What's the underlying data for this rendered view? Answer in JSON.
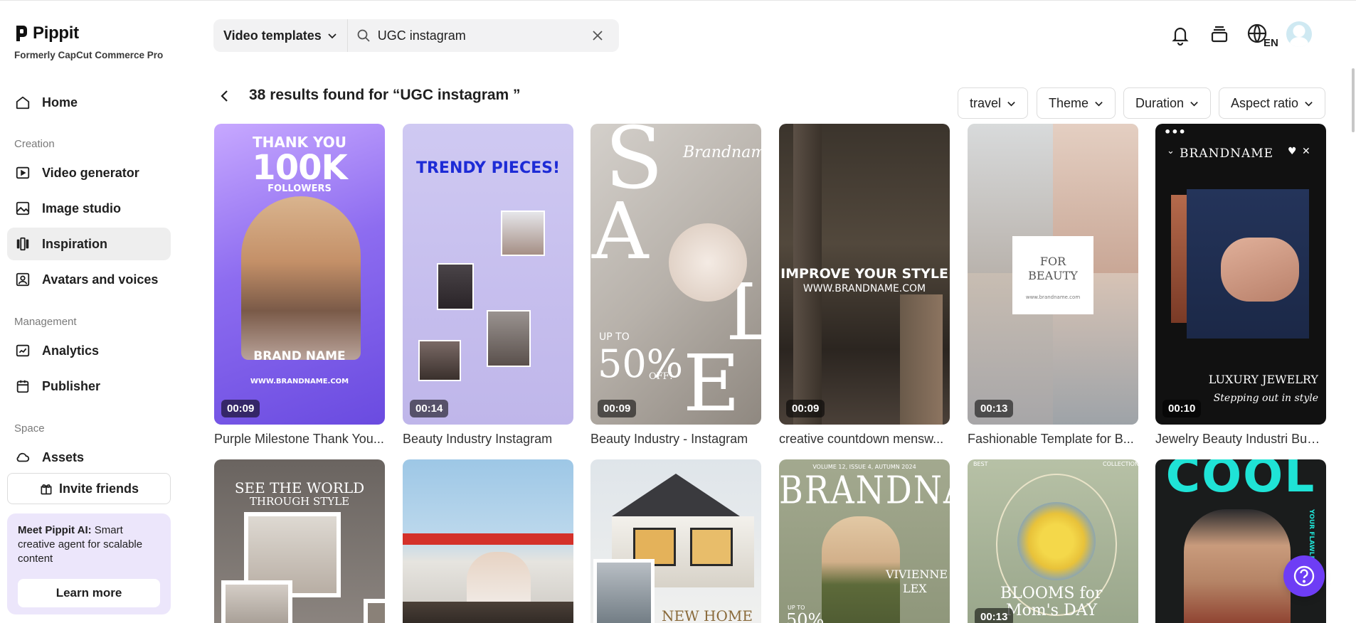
{
  "brand": {
    "name": "Pippit",
    "subtitle": "Formerly CapCut Commerce Pro"
  },
  "sidebar": {
    "home": {
      "label": "Home",
      "icon": "home-icon"
    },
    "creation_label": "Creation",
    "creation": [
      {
        "label": "Video generator",
        "icon": "video-generator-icon"
      },
      {
        "label": "Image studio",
        "icon": "image-studio-icon"
      },
      {
        "label": "Inspiration",
        "icon": "inspiration-icon",
        "active": true
      },
      {
        "label": "Avatars and voices",
        "icon": "avatar-voice-icon"
      }
    ],
    "management_label": "Management",
    "management": [
      {
        "label": "Analytics",
        "icon": "analytics-icon"
      },
      {
        "label": "Publisher",
        "icon": "calendar-icon"
      }
    ],
    "space_label": "Space",
    "space": [
      {
        "label": "Assets",
        "icon": "cloud-icon"
      }
    ],
    "invite": "Invite friends",
    "promo": {
      "title": "Meet Pippit AI:",
      "text": " Smart creative agent for scalable content",
      "button": "Learn more"
    }
  },
  "search": {
    "type": "Video templates",
    "value": "UGC instagram"
  },
  "results": {
    "title": "38 results found for “UGC instagram ”"
  },
  "filters": [
    "travel",
    "Theme",
    "Duration",
    "Aspect ratio"
  ],
  "cards_row1": [
    {
      "title": "Purple Milestone Thank You...",
      "duration": "00:09",
      "overlay": {
        "t1": "THANK YOU",
        "t2": "100K",
        "t3": "FOLLOWERS",
        "t4": "BRAND NAME",
        "t5": "WWW.BRANDNAME.COM"
      }
    },
    {
      "title": "Beauty Industry Instagram",
      "duration": "00:14",
      "overlay": {
        "t1": "TRENDY PIECES!"
      }
    },
    {
      "title": "Beauty Industry - Instagram",
      "duration": "00:09",
      "overlay": {
        "brand": "Brandname",
        "upto": "UP TO",
        "pct": "50%",
        "off": "OFF!"
      }
    },
    {
      "title": "creative countdown mensw...",
      "duration": "00:09",
      "overlay": {
        "t1": "IMPROVE YOUR STYLE",
        "t2": "WWW.BRANDNAME.COM"
      }
    },
    {
      "title": "Fashionable Template for B...",
      "duration": "00:13",
      "overlay": {
        "t1": "FOR",
        "t2": "BEAUTY",
        "t3": "www.brandname.com"
      }
    },
    {
      "title": "Jewelry Beauty Industri Busi...",
      "duration": "00:10",
      "overlay": {
        "brand": "BRANDNAME",
        "t1": "LUXURY JEWELRY",
        "t2": "Stepping out in style"
      }
    }
  ],
  "cards_row2": [
    {
      "overlay": {
        "t1": "SEE THE WORLD",
        "t2": "THROUGH STYLE"
      }
    },
    {
      "overlay": {}
    },
    {
      "overlay": {
        "t1": "NEW HOME"
      }
    },
    {
      "overlay": {
        "t0": "VOLUME 12, ISSUE 4, AUTUMN 2024",
        "t1": "BRANDNAME",
        "t2": "VIVIENNE",
        "t3": "LEX",
        "t4": "UP TO",
        "t5": "50%"
      }
    },
    {
      "duration": "00:13",
      "overlay": {
        "t0": "BEST",
        "t00": "COLLECTION",
        "t1": "BLOOMS for",
        "t2": "Mom's DAY"
      }
    },
    {
      "overlay": {
        "t1": "COOL",
        "t2": "YOUR FLAWLESS"
      }
    }
  ],
  "colors": {
    "accent": "#6e3df5",
    "promo_bg": "#ece6fb",
    "active_bg": "#eeeeee"
  }
}
